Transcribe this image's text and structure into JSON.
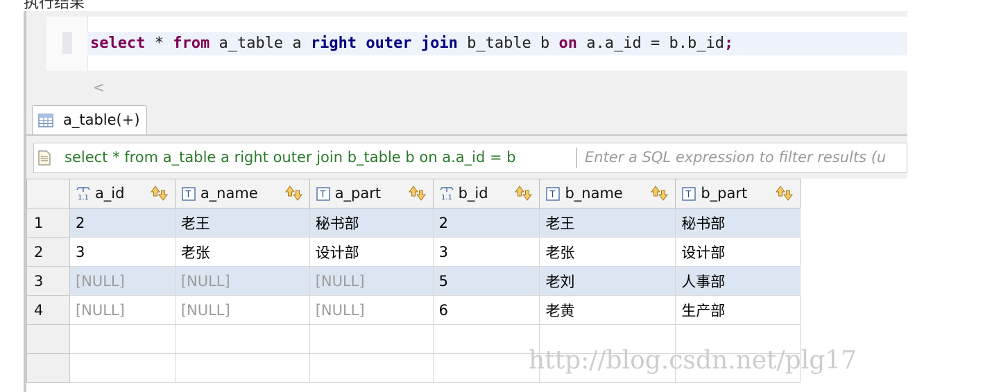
{
  "page": {
    "caption": "执行结果",
    "watermark": "http://blog.csdn.net/plg17"
  },
  "editor": {
    "sql_tokens": [
      {
        "text": "select",
        "style": "kw1"
      },
      {
        "text": " * ",
        "style": "plain"
      },
      {
        "text": "from",
        "style": "kw1"
      },
      {
        "text": " a_table a ",
        "style": "plain"
      },
      {
        "text": "right outer join",
        "style": "kw2"
      },
      {
        "text": " b_table b ",
        "style": "plain"
      },
      {
        "text": "on",
        "style": "kw1"
      },
      {
        "text": " a.a_id = b.b_id",
        "style": "plain"
      },
      {
        "text": ";",
        "style": "kw1"
      }
    ],
    "scroll_left_glyph": "<"
  },
  "tab": {
    "label": "a_table(+)"
  },
  "filter": {
    "query": "select * from a_table a right outer join b_table b on a.a_id = b",
    "placeholder": "Enter a SQL expression to filter results (u"
  },
  "grid": {
    "columns": [
      {
        "name": "a_id",
        "type": "numeric"
      },
      {
        "name": "a_name",
        "type": "text"
      },
      {
        "name": "a_part",
        "type": "text"
      },
      {
        "name": "b_id",
        "type": "numeric"
      },
      {
        "name": "b_name",
        "type": "text"
      },
      {
        "name": "b_part",
        "type": "text"
      }
    ],
    "rows": [
      {
        "num": "1",
        "selected": true,
        "cells": [
          "2",
          "老王",
          "秘书部",
          "2",
          "老王",
          "秘书部"
        ]
      },
      {
        "num": "2",
        "selected": false,
        "cells": [
          "3",
          "老张",
          "设计部",
          "3",
          "老张",
          "设计部"
        ]
      },
      {
        "num": "3",
        "selected": true,
        "cells": [
          "[NULL]",
          "[NULL]",
          "[NULL]",
          "5",
          "老刘",
          "人事部"
        ]
      },
      {
        "num": "4",
        "selected": false,
        "cells": [
          "[NULL]",
          "[NULL]",
          "[NULL]",
          "6",
          "老黄",
          "生产部"
        ]
      }
    ],
    "null_text": "[NULL]",
    "empty_rows": 2
  },
  "colors": {
    "keyword_primary": "#7f0055",
    "keyword_secondary": "#000080",
    "filter_text": "#2d7a2d",
    "selected_row": "#dce6f2",
    "null_text": "#9c9c9c"
  }
}
